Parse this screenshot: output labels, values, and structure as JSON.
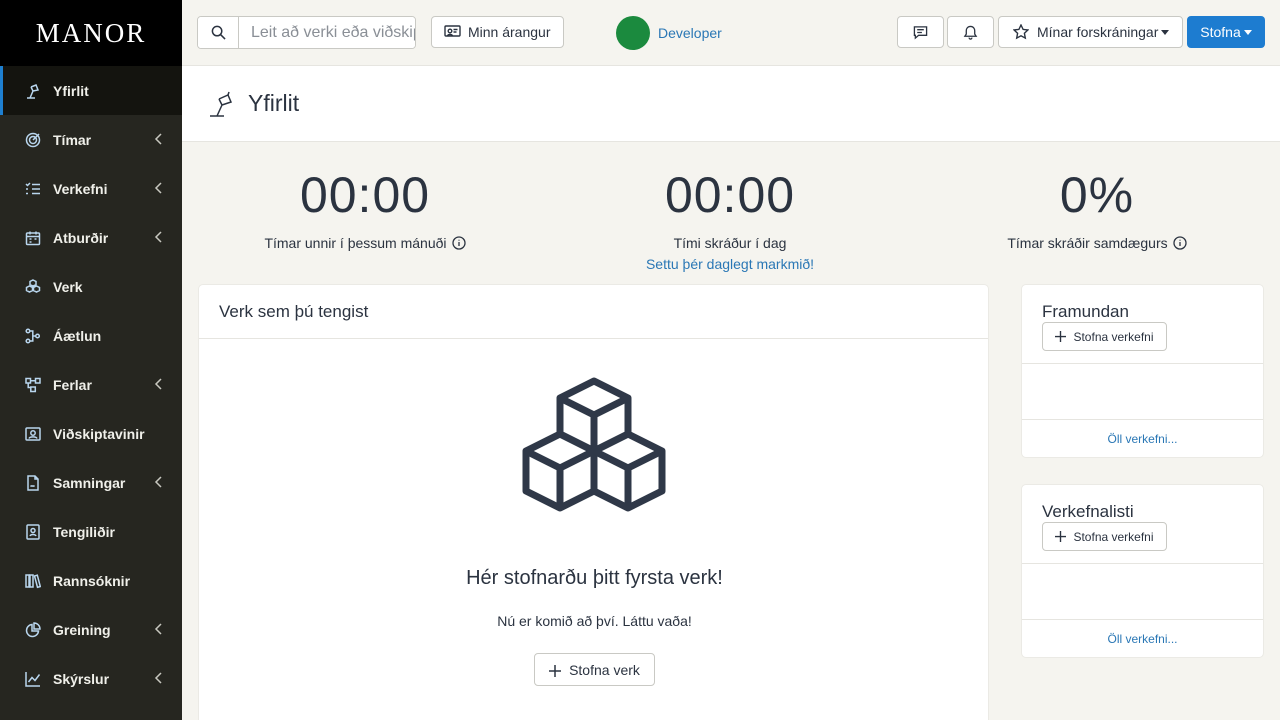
{
  "app": {
    "logo": "MANOR"
  },
  "sidebar": {
    "items": [
      {
        "label": "Yfirlit",
        "icon": "desk-lamp-icon",
        "active": true,
        "expandable": false
      },
      {
        "label": "Tímar",
        "icon": "target-icon",
        "expandable": true
      },
      {
        "label": "Verkefni",
        "icon": "checklist-icon",
        "expandable": true
      },
      {
        "label": "Atburðir",
        "icon": "calendar-icon",
        "expandable": true
      },
      {
        "label": "Verk",
        "icon": "cubes-icon",
        "expandable": false
      },
      {
        "label": "Áætlun",
        "icon": "workflow-icon",
        "expandable": false
      },
      {
        "label": "Ferlar",
        "icon": "process-icon",
        "expandable": true
      },
      {
        "label": "Viðskiptavinir",
        "icon": "client-icon",
        "expandable": false
      },
      {
        "label": "Samningar",
        "icon": "contract-icon",
        "expandable": true
      },
      {
        "label": "Tengiliðir",
        "icon": "contact-icon",
        "expandable": false
      },
      {
        "label": "Rannsóknir",
        "icon": "books-icon",
        "expandable": false
      },
      {
        "label": "Greining",
        "icon": "pie-chart-icon",
        "expandable": true
      },
      {
        "label": "Skýrslur",
        "icon": "line-chart-icon",
        "expandable": true
      }
    ]
  },
  "topbar": {
    "search_placeholder": "Leit að verki eða viðskiptavini",
    "achievement_label": "Minn árangur",
    "user_name": "Developer",
    "favorites_label": "Mínar forskráningar",
    "create_label": "Stofna"
  },
  "page": {
    "title": "Yfirlit"
  },
  "stats": [
    {
      "value": "00:00",
      "label": "Tímar unnir í þessum mánuði",
      "has_info": true
    },
    {
      "value": "00:00",
      "label": "Tími skráður í dag",
      "link": "Settu þér daglegt markmið!"
    },
    {
      "value": "0%",
      "label": "Tímar skráðir samdægurs",
      "has_info": true
    }
  ],
  "projects_card": {
    "title": "Verk sem þú tengist",
    "empty_title": "Hér stofnarðu þitt fyrsta verk!",
    "empty_subtitle": "Nú er komið að því. Láttu vaða!",
    "create_label": "Stofna verk"
  },
  "upcoming_card": {
    "title": "Framundan",
    "create_label": "Stofna verkefni",
    "link_label": "Öll verkefni..."
  },
  "tasklist_card": {
    "title": "Verkefnalisti",
    "create_label": "Stofna verkefni",
    "link_label": "Öll verkefni..."
  },
  "colors": {
    "sidebar_bg": "#262620",
    "accent": "#1d7cd0",
    "link": "#2a77b5",
    "avatar": "#1b8a3e"
  }
}
